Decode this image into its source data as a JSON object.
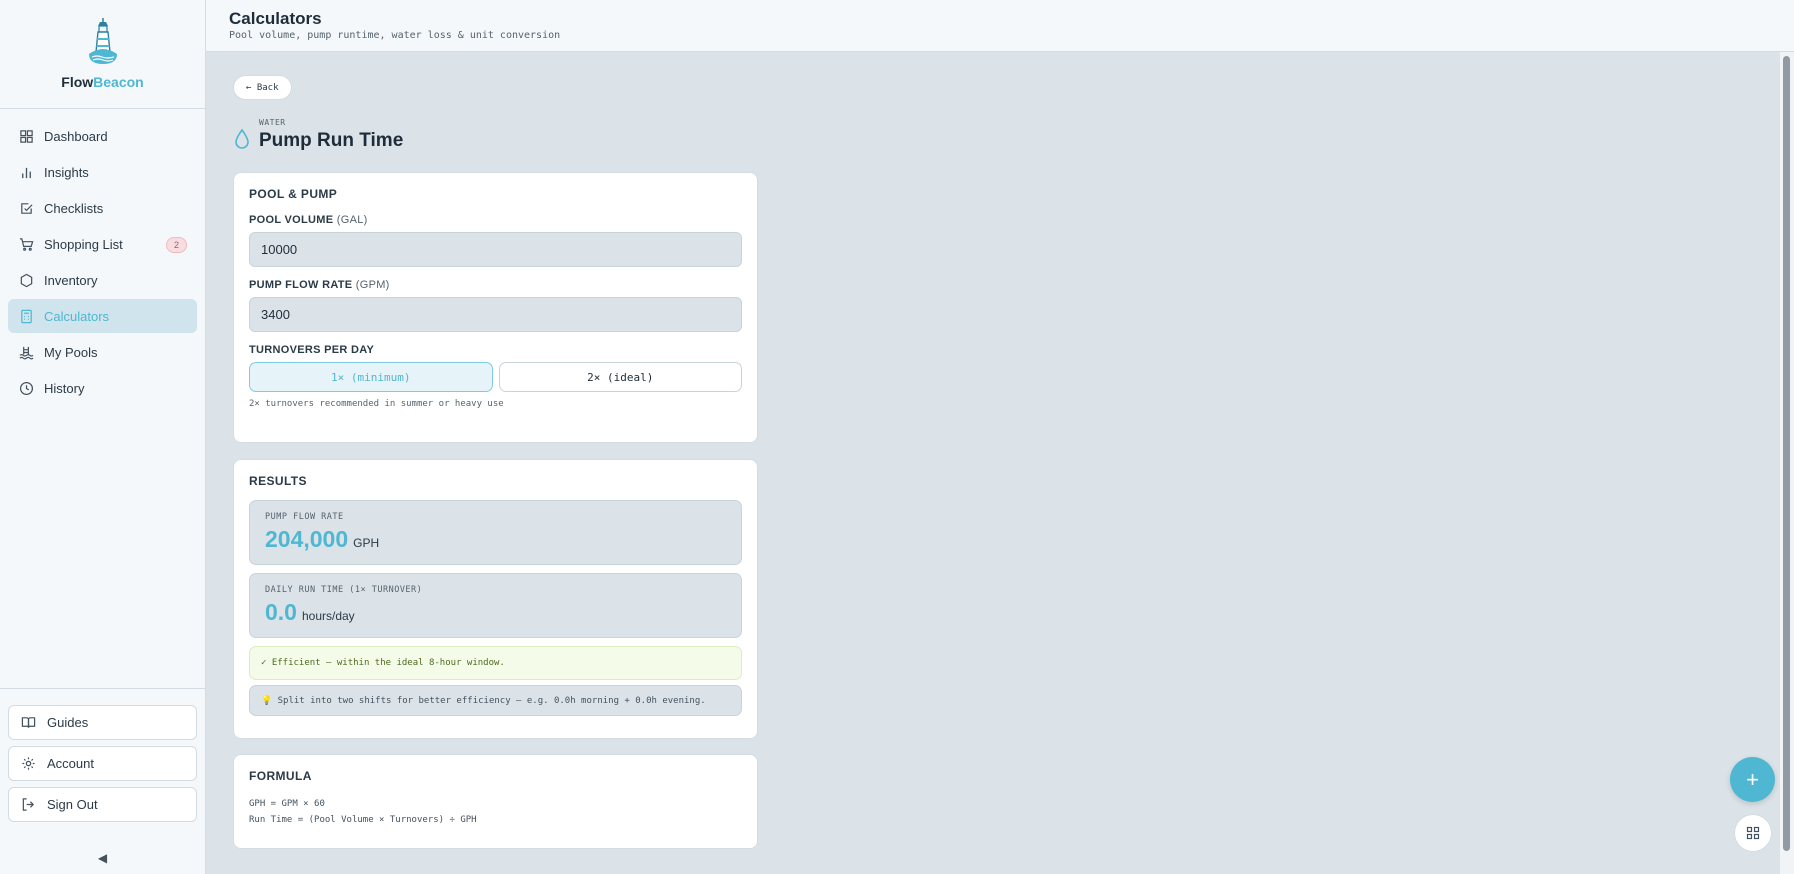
{
  "brand": {
    "name_part1": "Flow",
    "name_part2": "Beacon",
    "accent_color": "#4fb7d1"
  },
  "sidebar": {
    "items": [
      {
        "label": "Dashboard",
        "icon": "grid-icon"
      },
      {
        "label": "Insights",
        "icon": "bar-chart-icon"
      },
      {
        "label": "Checklists",
        "icon": "checkbox-icon"
      },
      {
        "label": "Shopping List",
        "icon": "cart-icon",
        "badge": "2"
      },
      {
        "label": "Inventory",
        "icon": "hexagon-icon"
      },
      {
        "label": "Calculators",
        "icon": "calculator-icon",
        "active": true
      },
      {
        "label": "My Pools",
        "icon": "pool-icon"
      },
      {
        "label": "History",
        "icon": "clock-icon"
      }
    ],
    "bottom": [
      {
        "label": "Guides",
        "icon": "book-icon"
      },
      {
        "label": "Account",
        "icon": "gear-icon"
      },
      {
        "label": "Sign Out",
        "icon": "sign-out-icon"
      }
    ],
    "collapse_glyph": "◀"
  },
  "header": {
    "title": "Calculators",
    "subtitle": "Pool volume, pump runtime, water loss & unit conversion"
  },
  "main": {
    "back_label": "← Back",
    "category": "WATER",
    "title": "Pump Run Time",
    "pool_pump": {
      "title": "POOL & PUMP",
      "volume_label": "POOL VOLUME",
      "volume_unit": "(GAL)",
      "volume_value": "10000",
      "flow_label": "PUMP FLOW RATE",
      "flow_unit": "(GPM)",
      "flow_value": "3400",
      "turnovers_label": "TURNOVERS PER DAY",
      "turnover_options": [
        "1× (minimum)",
        "2× (ideal)"
      ],
      "turnover_selected": "1× (minimum)",
      "hint": "2× turnovers recommended in summer or heavy use"
    },
    "results": {
      "title": "RESULTS",
      "flow_label": "PUMP FLOW RATE",
      "flow_value": "204,000",
      "flow_unit": "GPH",
      "runtime_label": "DAILY RUN TIME (1× TURNOVER)",
      "runtime_value": "0.0",
      "runtime_unit": "hours/day",
      "status": "✓ Efficient — within the ideal 8-hour window.",
      "tip_icon": "lightbulb-icon",
      "tip": "💡 Split into two shifts for better efficiency — e.g. 0.0h morning + 0.0h evening."
    },
    "formula": {
      "title": "FORMULA",
      "line1": "GPH = GPM × 60",
      "line2": "Run Time = (Pool Volume × Turnovers) ÷ GPH"
    }
  },
  "fab": {
    "add_glyph": "+"
  }
}
